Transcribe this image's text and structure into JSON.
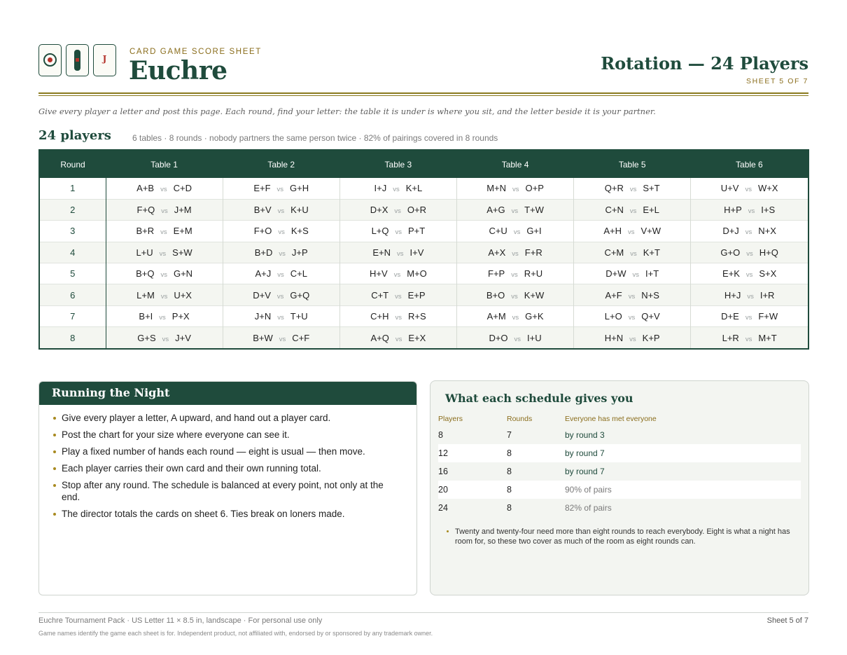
{
  "header": {
    "kicker": "CARD GAME SCORE SHEET",
    "title": "Euchre",
    "rotation_title": "Rotation — 24 Players",
    "sheet": "SHEET 5 OF 7",
    "card_icons": [
      "target-card-icon",
      "bar-card-icon",
      "jack-card-icon"
    ],
    "jack_letter": "J"
  },
  "intro": "Give every player a letter and post this page. Each round, find your letter: the table it is under is where you sit, and the letter beside it is your partner.",
  "section": {
    "title": "24 players",
    "subtitle": "6 tables · 8 rounds · nobody partners the same person twice · 82% of pairings covered in 8 rounds"
  },
  "rotation": {
    "headers": [
      "Round",
      "Table 1",
      "Table 2",
      "Table 3",
      "Table 4",
      "Table 5",
      "Table 6"
    ],
    "vs": "vs",
    "rows": [
      {
        "round": "1",
        "tables": [
          [
            "A+B",
            "C+D"
          ],
          [
            "E+F",
            "G+H"
          ],
          [
            "I+J",
            "K+L"
          ],
          [
            "M+N",
            "O+P"
          ],
          [
            "Q+R",
            "S+T"
          ],
          [
            "U+V",
            "W+X"
          ]
        ]
      },
      {
        "round": "2",
        "tables": [
          [
            "F+Q",
            "J+M"
          ],
          [
            "B+V",
            "K+U"
          ],
          [
            "D+X",
            "O+R"
          ],
          [
            "A+G",
            "T+W"
          ],
          [
            "C+N",
            "E+L"
          ],
          [
            "H+P",
            "I+S"
          ]
        ]
      },
      {
        "round": "3",
        "tables": [
          [
            "B+R",
            "E+M"
          ],
          [
            "F+O",
            "K+S"
          ],
          [
            "L+Q",
            "P+T"
          ],
          [
            "C+U",
            "G+I"
          ],
          [
            "A+H",
            "V+W"
          ],
          [
            "D+J",
            "N+X"
          ]
        ]
      },
      {
        "round": "4",
        "tables": [
          [
            "L+U",
            "S+W"
          ],
          [
            "B+D",
            "J+P"
          ],
          [
            "E+N",
            "I+V"
          ],
          [
            "A+X",
            "F+R"
          ],
          [
            "C+M",
            "K+T"
          ],
          [
            "G+O",
            "H+Q"
          ]
        ]
      },
      {
        "round": "5",
        "tables": [
          [
            "B+Q",
            "G+N"
          ],
          [
            "A+J",
            "C+L"
          ],
          [
            "H+V",
            "M+O"
          ],
          [
            "F+P",
            "R+U"
          ],
          [
            "D+W",
            "I+T"
          ],
          [
            "E+K",
            "S+X"
          ]
        ]
      },
      {
        "round": "6",
        "tables": [
          [
            "L+M",
            "U+X"
          ],
          [
            "D+V",
            "G+Q"
          ],
          [
            "C+T",
            "E+P"
          ],
          [
            "B+O",
            "K+W"
          ],
          [
            "A+F",
            "N+S"
          ],
          [
            "H+J",
            "I+R"
          ]
        ]
      },
      {
        "round": "7",
        "tables": [
          [
            "B+I",
            "P+X"
          ],
          [
            "J+N",
            "T+U"
          ],
          [
            "C+H",
            "R+S"
          ],
          [
            "A+M",
            "G+K"
          ],
          [
            "L+O",
            "Q+V"
          ],
          [
            "D+E",
            "F+W"
          ]
        ]
      },
      {
        "round": "8",
        "tables": [
          [
            "G+S",
            "J+V"
          ],
          [
            "B+W",
            "C+F"
          ],
          [
            "A+Q",
            "E+X"
          ],
          [
            "D+O",
            "I+U"
          ],
          [
            "H+N",
            "K+P"
          ],
          [
            "L+R",
            "M+T"
          ]
        ]
      }
    ]
  },
  "running": {
    "title": "Running the Night",
    "items": [
      "Give every player a letter, A upward, and hand out a player card.",
      "Post the chart for your size where everyone can see it.",
      "Play a fixed number of hands each round — eight is usual — then move.",
      "Each player carries their own card and their own running total.",
      "Stop after any round. The schedule is balanced at every point, not only at the end.",
      "The director totals the cards on sheet 6. Ties break on loners made."
    ]
  },
  "schedule": {
    "title": "What each schedule gives you",
    "headers": [
      "Players",
      "Rounds",
      "Everyone has met everyone"
    ],
    "rows": [
      {
        "players": "8",
        "rounds": "7",
        "met": "by round 3",
        "partial": false
      },
      {
        "players": "12",
        "rounds": "8",
        "met": "by round 7",
        "partial": false
      },
      {
        "players": "16",
        "rounds": "8",
        "met": "by round 7",
        "partial": false
      },
      {
        "players": "20",
        "rounds": "8",
        "met": "90% of pairs",
        "partial": true
      },
      {
        "players": "24",
        "rounds": "8",
        "met": "82% of pairs",
        "partial": true
      }
    ],
    "note": "Twenty and twenty-four need more than eight rounds to reach everybody. Eight is what a night has room for, so these two cover as much of the room as eight rounds can."
  },
  "footer": {
    "left": "Euchre Tournament Pack · US Letter 11 × 8.5 in, landscape · For personal use only",
    "right": "Sheet 5 of 7",
    "disclaimer": "Game names identify the game each sheet is for. Independent product, not affiliated with, endorsed by or sponsored by any trademark owner."
  },
  "colors": {
    "primary": "#1f4b3c",
    "accent": "#8a6d1c",
    "suit_red": "#b3322a"
  }
}
